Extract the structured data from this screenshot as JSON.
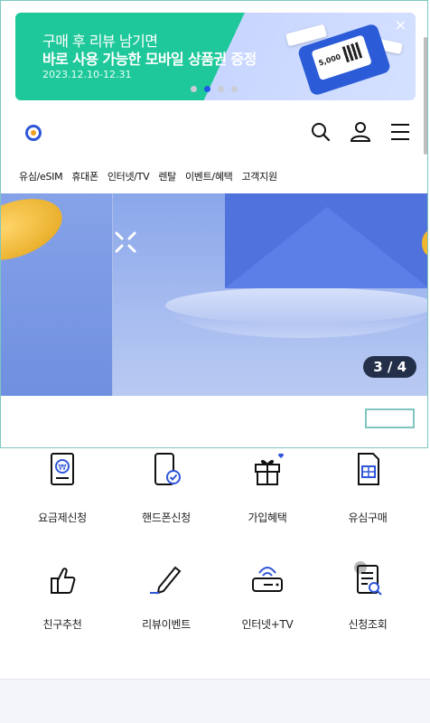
{
  "promo": {
    "line1": "구매 후 리뷰 남기면",
    "line2": "바로 사용 가능한 모바일 상품권 증정",
    "period": "2023.12.10-12.31",
    "coupon_amount": "5,000",
    "close_glyph": "×",
    "slides_total": 4,
    "slide_active": 2
  },
  "nav": [
    "유심/eSIM",
    "휴대폰",
    "인터넷/TV",
    "렌탈",
    "이벤트/혜택",
    "고객지원"
  ],
  "hero": {
    "counter": "3 / 4"
  },
  "quick_menu": [
    {
      "label": "요금제신청",
      "icon": "plan-document-icon"
    },
    {
      "label": "핸드폰신청",
      "icon": "phone-check-icon"
    },
    {
      "label": "가입혜택",
      "icon": "gift-icon"
    },
    {
      "label": "유심구매",
      "icon": "sim-card-icon"
    },
    {
      "label": "친구추천",
      "icon": "thumbs-up-icon"
    },
    {
      "label": "리뷰이벤트",
      "icon": "pencil-icon"
    },
    {
      "label": "인터넷+TV",
      "icon": "router-icon"
    },
    {
      "label": "신청조회",
      "icon": "clipboard-search-icon"
    }
  ],
  "colors": {
    "accent": "#1f57e6",
    "promo_green": "#1fc89a",
    "hero_blue": "#7d9be4"
  }
}
